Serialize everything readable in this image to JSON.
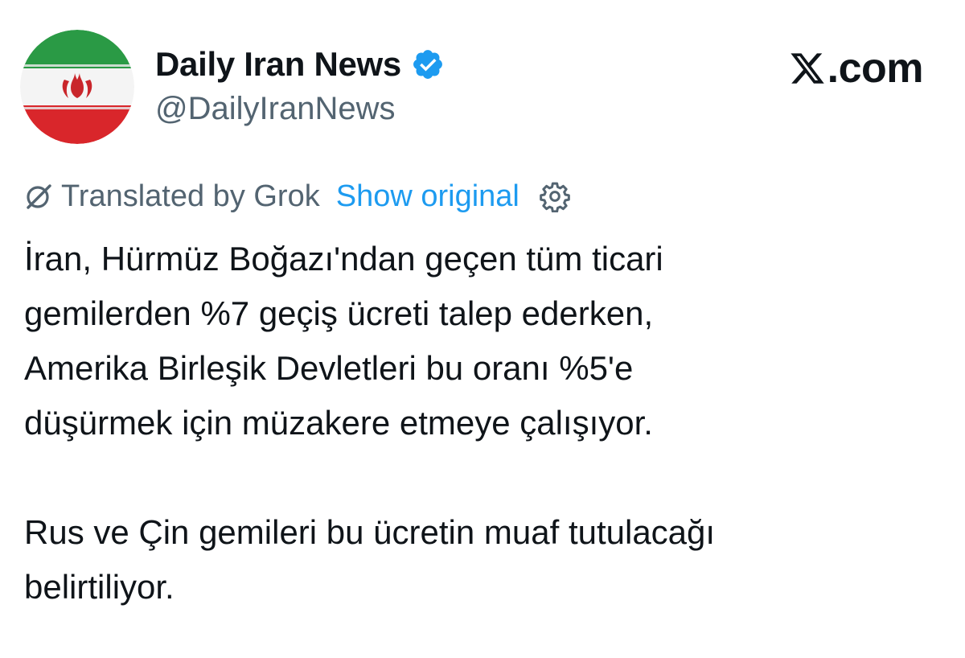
{
  "author": {
    "display_name": "Daily Iran News",
    "handle": "@DailyIranNews",
    "verified_icon": "verified-badge-icon",
    "avatar_icon": "iran-flag-avatar"
  },
  "brand": {
    "label": ".com",
    "icon": "x-logo-icon"
  },
  "translation": {
    "label": "Translated by Grok",
    "show_original": "Show original",
    "icon": "grok-icon",
    "settings_icon": "gear-icon"
  },
  "tweet": {
    "paragraphs": [
      [
        "İran, Hürmüz Boğazı'ndan geçen tüm ticari",
        "gemilerden %7 geçiş ücreti talep ederken,",
        "Amerika Birleşik Devletleri bu oranı %5'e",
        "düşürmek için müzakere etmeye çalışıyor."
      ],
      [
        "Rus ve Çin gemileri bu ücretin muaf tutulacağı",
        "belirtiliyor."
      ]
    ]
  },
  "colors": {
    "text": "#0f1419",
    "secondary": "#536471",
    "link": "#1d9bf0",
    "verified": "#1d9bf0",
    "flag_green": "#239f40",
    "flag_red": "#da0000",
    "flag_white": "#ffffff"
  }
}
